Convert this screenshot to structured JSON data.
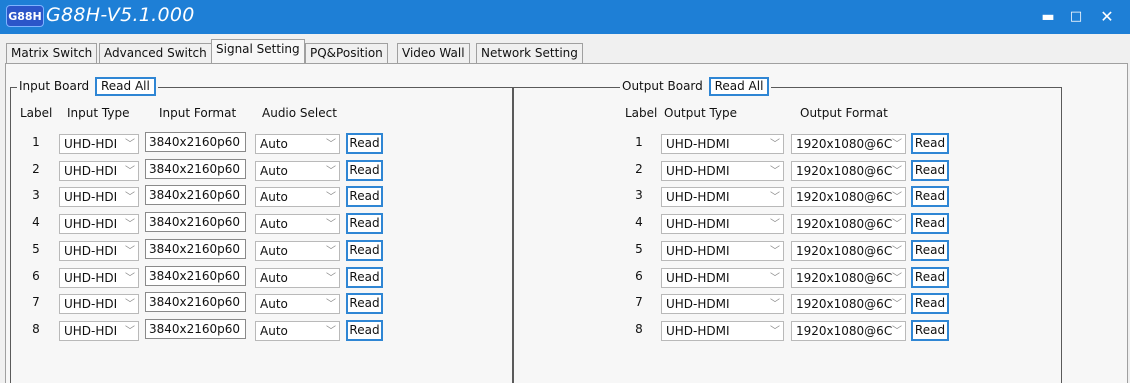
{
  "app": {
    "logo": "G88H",
    "title": "G88H-V5.1.000"
  },
  "window_controls": {
    "minimize": "▬",
    "maximize": "□",
    "close": "✕"
  },
  "tabs": [
    {
      "label": "Matrix Switch"
    },
    {
      "label": "Advanced Switch"
    },
    {
      "label": "Signal Setting"
    },
    {
      "label": "PQ&Position"
    },
    {
      "label": "Video Wall"
    },
    {
      "label": "Network Setting"
    }
  ],
  "active_tab": "Signal Setting",
  "input_board": {
    "title": "Input Board",
    "read_all": "Read All",
    "headers": {
      "label": "Label",
      "type": "Input Type",
      "format": "Input Format",
      "audio": "Audio Select"
    },
    "rows": [
      {
        "label": "1",
        "type": "UHD-HDI",
        "format": "3840x2160p60",
        "audio": "Auto",
        "read": "Read"
      },
      {
        "label": "2",
        "type": "UHD-HDI",
        "format": "3840x2160p60",
        "audio": "Auto",
        "read": "Read"
      },
      {
        "label": "3",
        "type": "UHD-HDI",
        "format": "3840x2160p60",
        "audio": "Auto",
        "read": "Read"
      },
      {
        "label": "4",
        "type": "UHD-HDI",
        "format": "3840x2160p60",
        "audio": "Auto",
        "read": "Read"
      },
      {
        "label": "5",
        "type": "UHD-HDI",
        "format": "3840x2160p60",
        "audio": "Auto",
        "read": "Read"
      },
      {
        "label": "6",
        "type": "UHD-HDI",
        "format": "3840x2160p60",
        "audio": "Auto",
        "read": "Read"
      },
      {
        "label": "7",
        "type": "UHD-HDI",
        "format": "3840x2160p60",
        "audio": "Auto",
        "read": "Read"
      },
      {
        "label": "8",
        "type": "UHD-HDI",
        "format": "3840x2160p60",
        "audio": "Auto",
        "read": "Read"
      }
    ]
  },
  "output_board": {
    "title": "Output Board",
    "read_all": "Read All",
    "headers": {
      "label": "Label",
      "type": "Output Type",
      "format": "Output Format"
    },
    "rows": [
      {
        "label": "1",
        "type": "UHD-HDMI",
        "format": "1920x1080@6C",
        "read": "Read"
      },
      {
        "label": "2",
        "type": "UHD-HDMI",
        "format": "1920x1080@6C",
        "read": "Read"
      },
      {
        "label": "3",
        "type": "UHD-HDMI",
        "format": "1920x1080@6C",
        "read": "Read"
      },
      {
        "label": "4",
        "type": "UHD-HDMI",
        "format": "1920x1080@6C",
        "read": "Read"
      },
      {
        "label": "5",
        "type": "UHD-HDMI",
        "format": "1920x1080@6C",
        "read": "Read"
      },
      {
        "label": "6",
        "type": "UHD-HDMI",
        "format": "1920x1080@6C",
        "read": "Read"
      },
      {
        "label": "7",
        "type": "UHD-HDMI",
        "format": "1920x1080@6C",
        "read": "Read"
      },
      {
        "label": "8",
        "type": "UHD-HDMI",
        "format": "1920x1080@6C",
        "read": "Read"
      }
    ]
  },
  "colors": {
    "titlebar": "#1e7fd6",
    "accent_border": "#2f86d4",
    "logo_bg": "#2b55c9"
  }
}
